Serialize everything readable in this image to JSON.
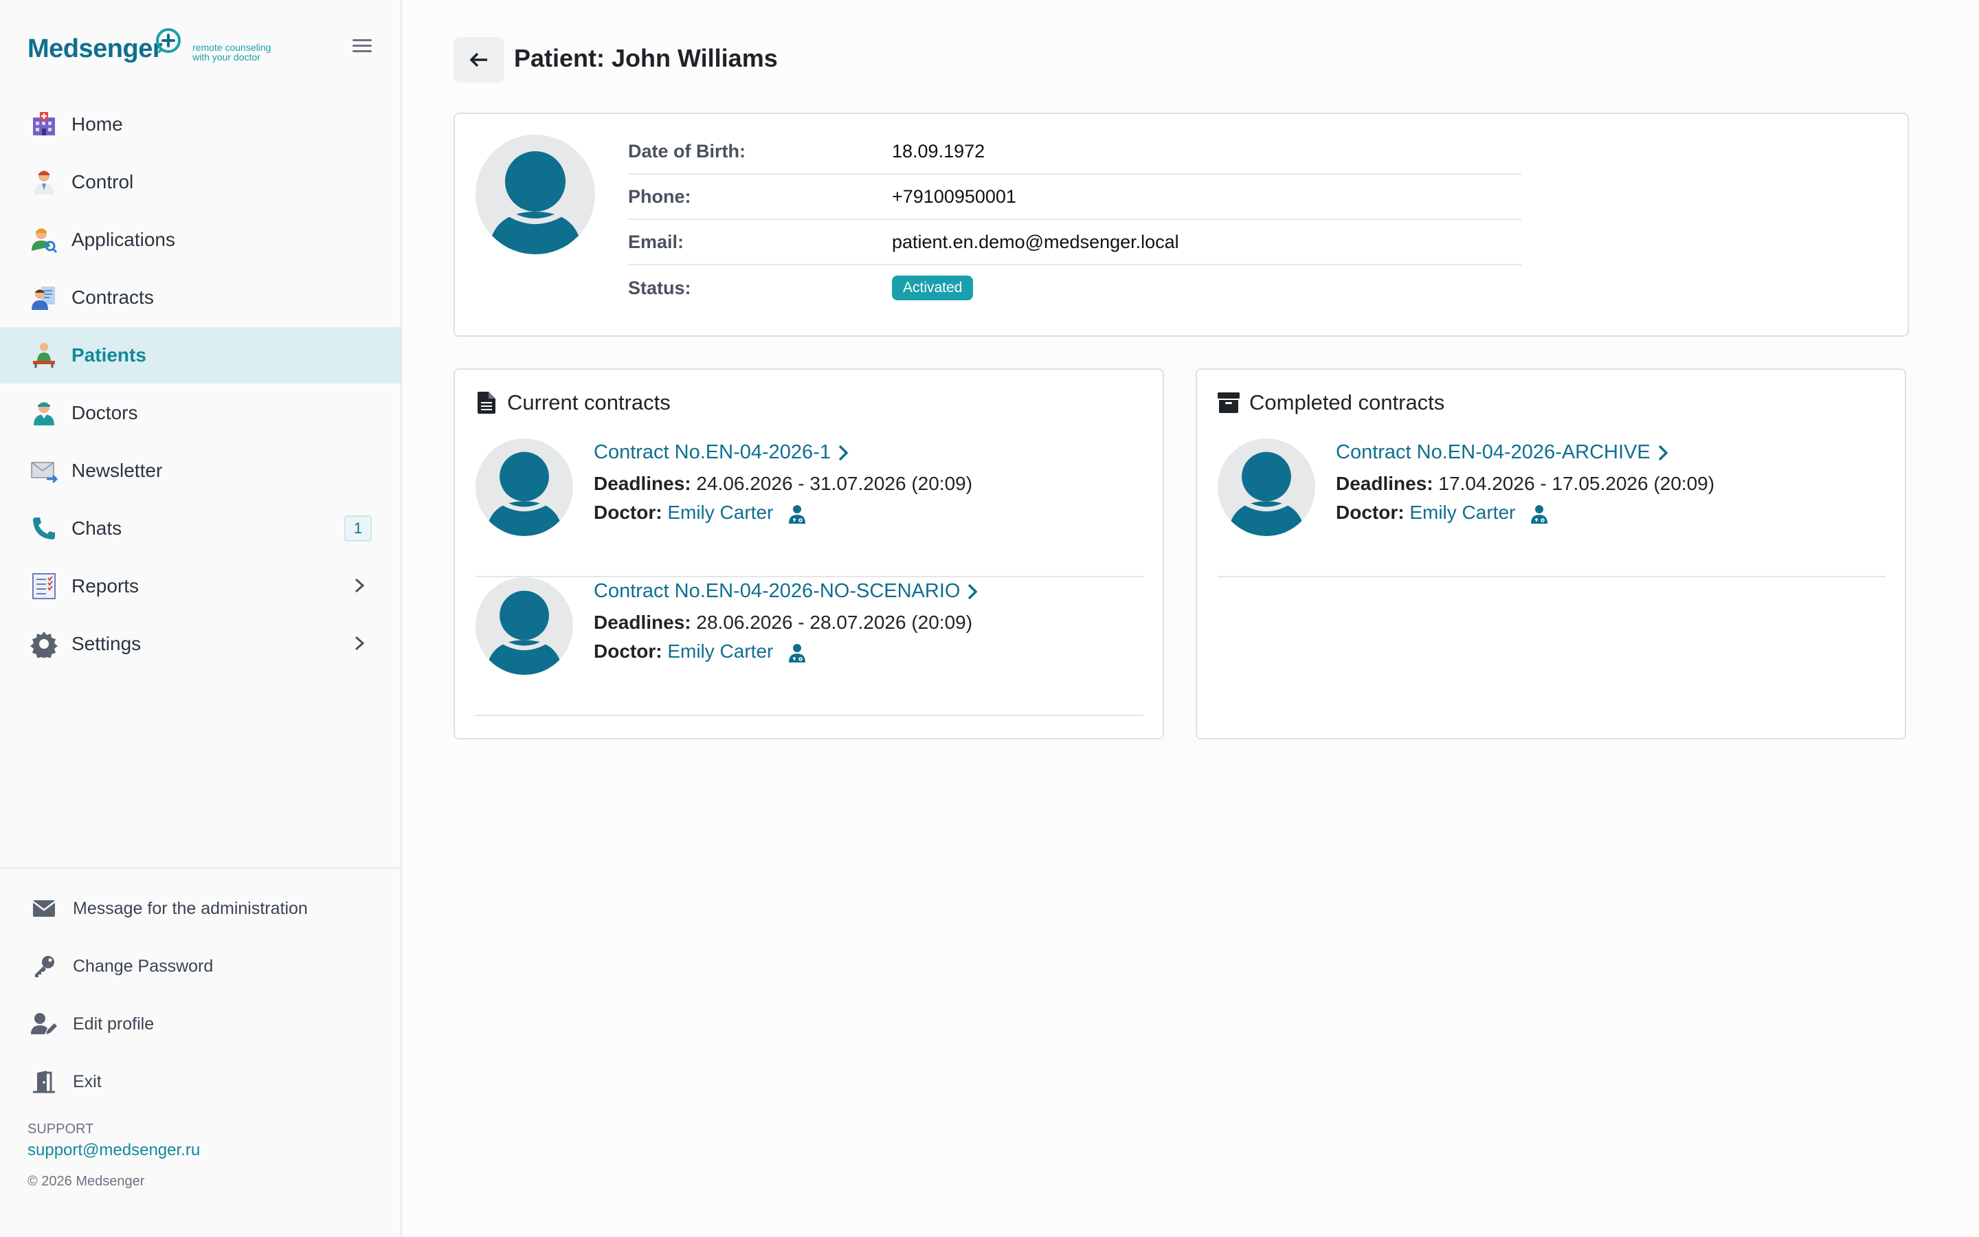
{
  "brand": {
    "name_part1": "Med",
    "name_part2": "senger",
    "tagline_line1": "remote counseling",
    "tagline_line2": "with your doctor"
  },
  "sidebar": {
    "items": [
      {
        "label": "Home",
        "icon": "hospital-icon"
      },
      {
        "label": "Control",
        "icon": "doctor-icon"
      },
      {
        "label": "Applications",
        "icon": "user-search-icon"
      },
      {
        "label": "Contracts",
        "icon": "contract-icon"
      },
      {
        "label": "Patients",
        "icon": "patient-icon",
        "active": true
      },
      {
        "label": "Doctors",
        "icon": "nurse-icon"
      },
      {
        "label": "Newsletter",
        "icon": "envelope-arrow-icon"
      },
      {
        "label": "Chats",
        "icon": "phone-icon",
        "badge": "1"
      },
      {
        "label": "Reports",
        "icon": "report-icon",
        "has_children": true
      },
      {
        "label": "Settings",
        "icon": "gear-icon",
        "has_children": true
      }
    ],
    "bottom_items": [
      {
        "label": "Message for the administration",
        "icon": "mail-icon"
      },
      {
        "label": "Change Password",
        "icon": "key-icon"
      },
      {
        "label": "Edit profile",
        "icon": "user-edit-icon"
      },
      {
        "label": "Exit",
        "icon": "exit-door-icon"
      }
    ],
    "support_label": "SUPPORT",
    "support_email": "support@medsenger.ru",
    "copyright": "© 2026 Medsenger"
  },
  "page": {
    "title": "Patient: John Williams"
  },
  "patient": {
    "rows": [
      {
        "label": "Date of Birth:",
        "value": "18.09.1972"
      },
      {
        "label": "Phone:",
        "value": "+79100950001"
      },
      {
        "label": "Email:",
        "value": "patient.en.demo@medsenger.local"
      },
      {
        "label": "Status:",
        "value": "Activated"
      }
    ]
  },
  "current_contracts": {
    "title": "Current contracts",
    "items": [
      {
        "name": "Contract No.EN-04-2026-1",
        "deadlines_label": "Deadlines:",
        "deadlines": "24.06.2026 - 31.07.2026 (20:09)",
        "doctor_label": "Doctor:",
        "doctor": "Emily Carter"
      },
      {
        "name": "Contract No.EN-04-2026-NO-SCENARIO",
        "deadlines_label": "Deadlines:",
        "deadlines": "28.06.2026 - 28.07.2026 (20:09)",
        "doctor_label": "Doctor:",
        "doctor": "Emily Carter"
      }
    ]
  },
  "completed_contracts": {
    "title": "Completed contracts",
    "items": [
      {
        "name": "Contract No.EN-04-2026-ARCHIVE",
        "deadlines_label": "Deadlines:",
        "deadlines": "17.04.2026 - 17.05.2026 (20:09)",
        "doctor_label": "Doctor:",
        "doctor": "Emily Carter"
      }
    ]
  },
  "colors": {
    "accent": "#0e6f8f",
    "active_bg": "#dceef1",
    "status_badge": "#19a0ac"
  }
}
